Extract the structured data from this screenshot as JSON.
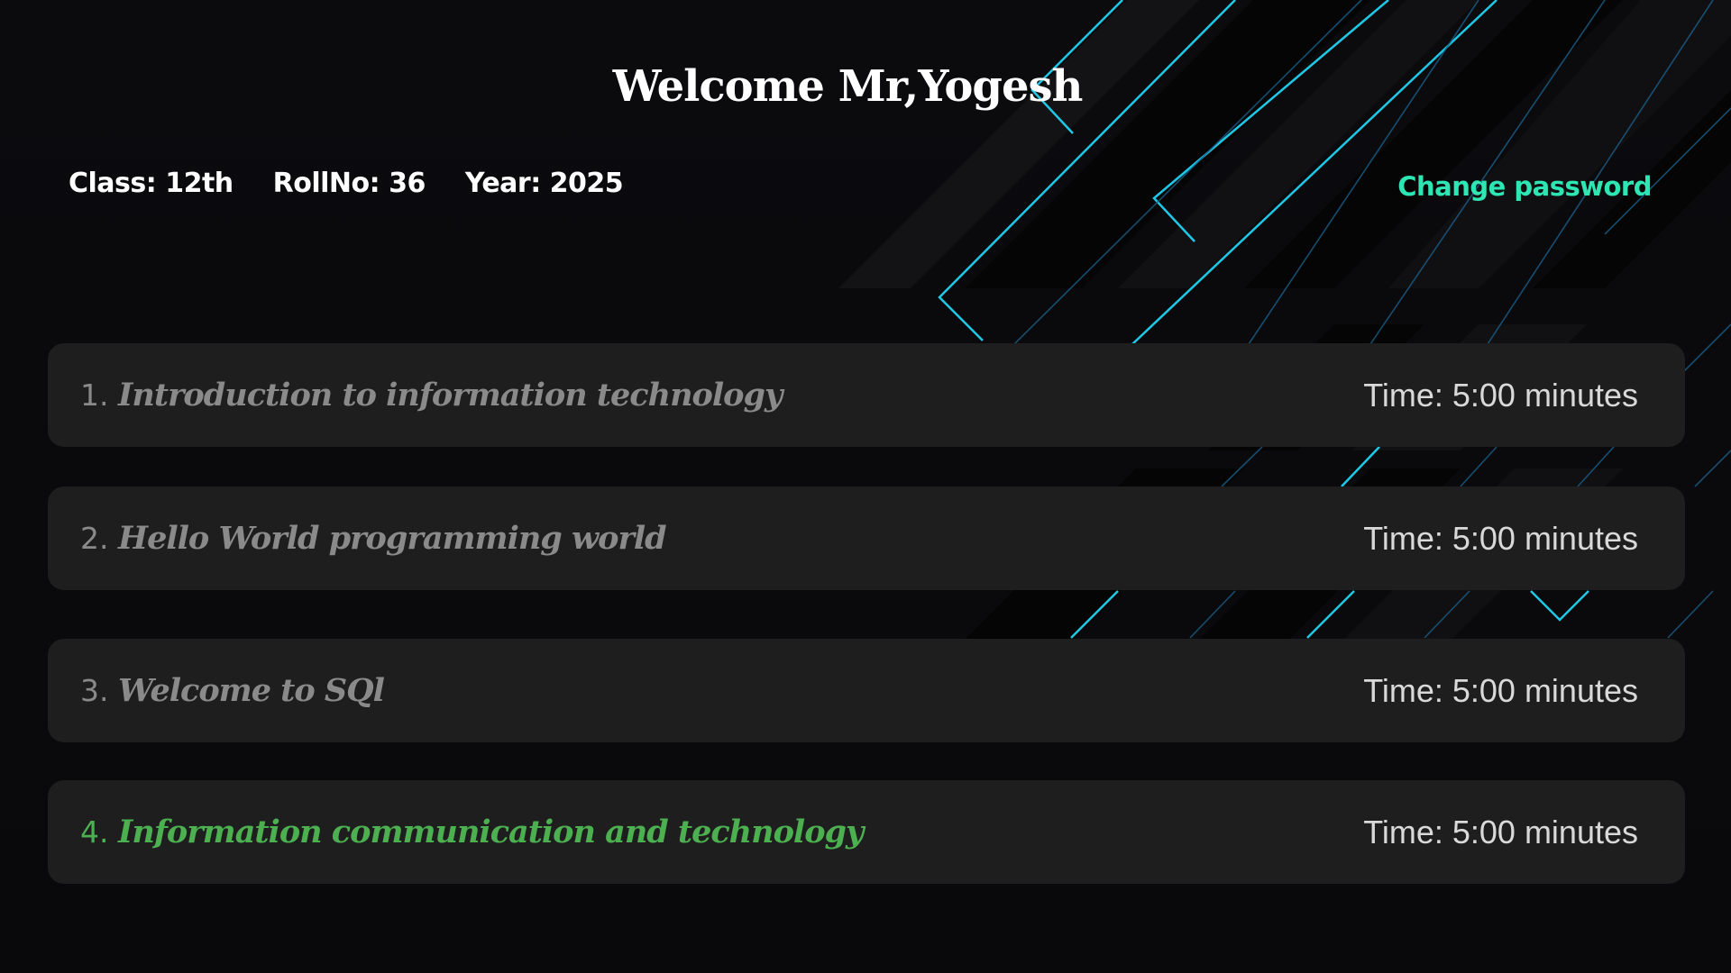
{
  "header": {
    "title": "Welcome Mr,Yogesh"
  },
  "student": {
    "class_label": "Class: 12th",
    "rollno_label": "RollNo: 36",
    "year_label": "Year: 2025"
  },
  "actions": {
    "change_password_label": "Change password"
  },
  "colors": {
    "background": "#0a0a0c",
    "card": "#1e1e1f",
    "accent_link": "#2ee6b3",
    "active_lesson": "#4caf50",
    "inactive_lesson": "#8a8a8a",
    "decor_line": "#1ec8e6"
  },
  "lessons": [
    {
      "number": "1.",
      "title": "Introduction to information technology",
      "time": "Time: 5:00 minutes",
      "active": false
    },
    {
      "number": "2.",
      "title": "Hello World programming world",
      "time": "Time: 5:00 minutes",
      "active": false
    },
    {
      "number": "3.",
      "title": "Welcome to SQl",
      "time": "Time: 5:00 minutes",
      "active": false
    },
    {
      "number": "4.",
      "title": "Information communication and technology",
      "time": "Time: 5:00 minutes",
      "active": true
    }
  ]
}
